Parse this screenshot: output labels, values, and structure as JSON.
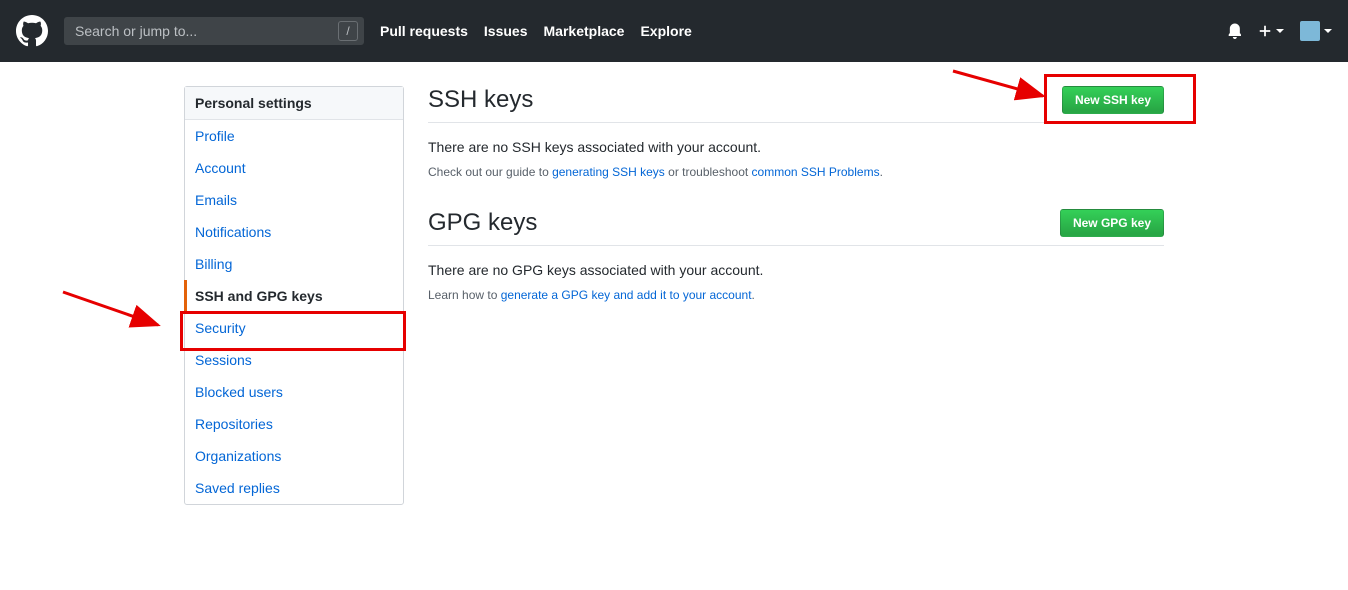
{
  "header": {
    "search_placeholder": "Search or jump to...",
    "nav": {
      "pull_requests": "Pull requests",
      "issues": "Issues",
      "marketplace": "Marketplace",
      "explore": "Explore"
    }
  },
  "sidebar": {
    "heading": "Personal settings",
    "items": {
      "profile": "Profile",
      "account": "Account",
      "emails": "Emails",
      "notifications": "Notifications",
      "billing": "Billing",
      "ssh_gpg": "SSH and GPG keys",
      "security": "Security",
      "sessions": "Sessions",
      "blocked_users": "Blocked users",
      "repositories": "Repositories",
      "organizations": "Organizations",
      "saved_replies": "Saved replies"
    }
  },
  "ssh": {
    "heading": "SSH keys",
    "button": "New SSH key",
    "empty": "There are no SSH keys associated with your account.",
    "hint_pre": "Check out our guide to ",
    "hint_link1": "generating SSH keys",
    "hint_mid": " or troubleshoot ",
    "hint_link2": "common SSH Problems",
    "hint_post": "."
  },
  "gpg": {
    "heading": "GPG keys",
    "button": "New GPG key",
    "empty": "There are no GPG keys associated with your account.",
    "hint_pre": "Learn how to ",
    "hint_link": "generate a GPG key and add it to your account",
    "hint_post": "."
  }
}
